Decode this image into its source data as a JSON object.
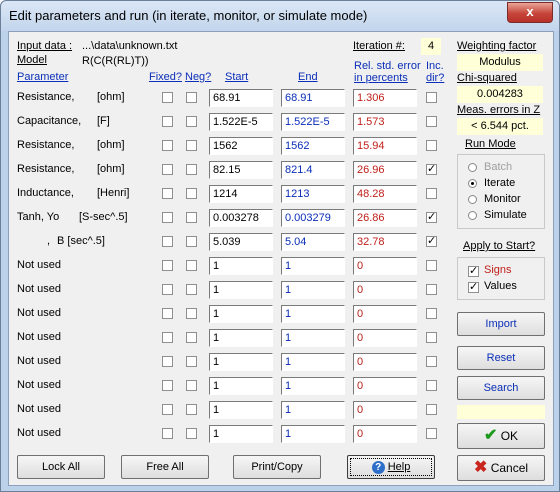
{
  "window": {
    "title": "Edit parameters and run (in iterate, monitor, or simulate mode)",
    "close_glyph": "x"
  },
  "input": {
    "label": "Input data :",
    "path": "...\\data\\unknown.txt",
    "model_label": "Model",
    "model": "R(C(R(RL)T))"
  },
  "iteration": {
    "label": "Iteration #:",
    "value": "4"
  },
  "headers": {
    "parameter": "Parameter",
    "fixed": "Fixed?",
    "neg": "Neg?",
    "start": "Start",
    "end": "End",
    "rel_line1": "Rel. std. error",
    "rel_line2": "in percents",
    "inc_line1": "Inc.",
    "inc_line2": "dir?"
  },
  "rows": [
    {
      "name": "Resistance,",
      "unit": "[ohm]",
      "fixed": false,
      "neg": false,
      "start": "68.91",
      "end": "68.91",
      "err": "1.306",
      "inc": false
    },
    {
      "name": "Capacitance,",
      "unit": "[F]",
      "fixed": false,
      "neg": false,
      "start": "1.522E-5",
      "end": "1.522E-5",
      "err": "1.573",
      "inc": false
    },
    {
      "name": "Resistance,",
      "unit": "[ohm]",
      "fixed": false,
      "neg": false,
      "start": "1562",
      "end": "1562",
      "err": "15.94",
      "inc": false
    },
    {
      "name": "Resistance,",
      "unit": "[ohm]",
      "fixed": false,
      "neg": false,
      "start": "82.15",
      "end": "821.4",
      "err": "26.96",
      "inc": true
    },
    {
      "name": "Inductance,",
      "unit": "[Henri]",
      "fixed": false,
      "neg": false,
      "start": "1214",
      "end": "1213",
      "err": "48.28",
      "inc": false
    },
    {
      "name": "Tanh, Yo",
      "unit": "[S-sec^.5]",
      "fixed": false,
      "neg": false,
      "start": "0.003278",
      "end": "0.003279",
      "err": "26.86",
      "inc": true
    },
    {
      "name": ",",
      "unit": "B [sec^.5]",
      "fixed": false,
      "neg": false,
      "start": "5.039",
      "end": "5.04",
      "err": "32.78",
      "inc": true
    },
    {
      "name": "Not used",
      "unit": "",
      "fixed": false,
      "neg": false,
      "start": "1",
      "end": "1",
      "err": "0",
      "inc": false
    },
    {
      "name": "Not used",
      "unit": "",
      "fixed": false,
      "neg": false,
      "start": "1",
      "end": "1",
      "err": "0",
      "inc": false
    },
    {
      "name": "Not used",
      "unit": "",
      "fixed": false,
      "neg": false,
      "start": "1",
      "end": "1",
      "err": "0",
      "inc": false
    },
    {
      "name": "Not used",
      "unit": "",
      "fixed": false,
      "neg": false,
      "start": "1",
      "end": "1",
      "err": "0",
      "inc": false
    },
    {
      "name": "Not used",
      "unit": "",
      "fixed": false,
      "neg": false,
      "start": "1",
      "end": "1",
      "err": "0",
      "inc": false
    },
    {
      "name": "Not used",
      "unit": "",
      "fixed": false,
      "neg": false,
      "start": "1",
      "end": "1",
      "err": "0",
      "inc": false
    },
    {
      "name": "Not used",
      "unit": "",
      "fixed": false,
      "neg": false,
      "start": "1",
      "end": "1",
      "err": "0",
      "inc": false
    },
    {
      "name": "Not used",
      "unit": "",
      "fixed": false,
      "neg": false,
      "start": "1",
      "end": "1",
      "err": "0",
      "inc": false
    }
  ],
  "right": {
    "weighting_label": "Weighting factor",
    "weighting_value": "Modulus",
    "chi_label": "Chi-squared",
    "chi_value": "0.004283",
    "meas_label": "Meas. errors in Z",
    "meas_value": "< 6.544 pct.",
    "run_mode_label": "Run Mode",
    "run_modes": [
      {
        "label": "Batch",
        "enabled": false
      },
      {
        "label": "Iterate",
        "enabled": true
      },
      {
        "label": "Monitor",
        "enabled": true
      },
      {
        "label": "Simulate",
        "enabled": true
      }
    ],
    "run_mode_selected": "Iterate",
    "apply_label": "Apply to Start?",
    "apply": {
      "signs_label": "Signs",
      "signs": true,
      "values_label": "Values",
      "values": true
    },
    "import_label": "Import",
    "reset_label": "Reset",
    "search_label": "Search",
    "ok_label": "OK",
    "cancel_label": "Cancel"
  },
  "bottom": {
    "lock_all": "Lock All",
    "free_all": "Free All",
    "print_copy": "Print/Copy",
    "help": "Help"
  },
  "colors": {
    "title_bg": "#c8daf0",
    "client_bg": "#f0f0f0",
    "link_blue": "#0b2fb8",
    "error_red": "#c0201b",
    "yellow_cell": "#ffffd8",
    "ok_green": "#1e9a1e",
    "cancel_red": "#c8261e"
  }
}
